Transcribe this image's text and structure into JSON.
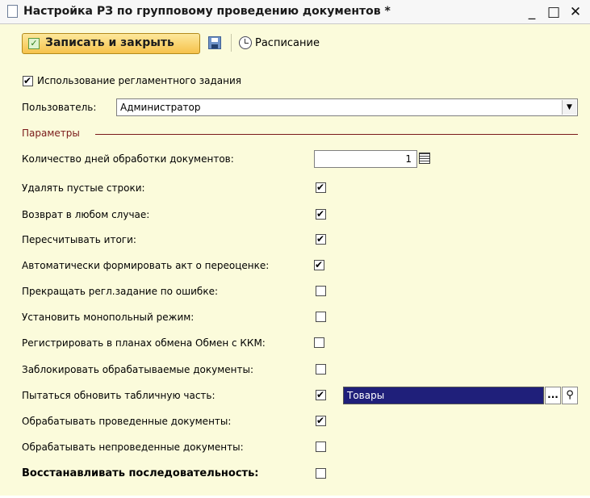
{
  "window": {
    "title": "Настройка РЗ по групповому проведению документов *",
    "controls": {
      "minimize": "_",
      "maximize": "□",
      "close": "✕"
    }
  },
  "toolbar": {
    "save_close_label": "Записать и закрыть",
    "schedule_label": "Расписание"
  },
  "use_task": {
    "label": "Использование регламентного задания",
    "checked": true
  },
  "user": {
    "label": "Пользователь:",
    "value": "Администратор"
  },
  "params": {
    "title": "Параметры",
    "days_label": "Количество дней обработки документов:",
    "days_value": "1",
    "rows": [
      {
        "label": "Удалять пустые строки:",
        "checked": true
      },
      {
        "label": "Возврат в любом случае:",
        "checked": true
      },
      {
        "label": "Пересчитывать итоги:",
        "checked": true
      },
      {
        "label": "Автоматически формировать акт о переоценке:",
        "checked": true
      },
      {
        "label": "Прекращать регл.задание по ошибке:",
        "checked": false
      },
      {
        "label": "Установить монопольный режим:",
        "checked": false
      },
      {
        "label": "Регистрировать в планах обмена Обмен с ККМ:",
        "checked": false
      },
      {
        "label": "Заблокировать обрабатываемые документы:",
        "checked": false
      },
      {
        "label": "Пытаться обновить табличную часть:",
        "checked": true
      },
      {
        "label": "Обрабатывать проведенные документы:",
        "checked": true
      },
      {
        "label": "Обрабатывать непроведенные документы:",
        "checked": false
      },
      {
        "label": "Восстанавливать последовательность:",
        "checked": false
      }
    ],
    "table_part_value": "Товары",
    "ellipsis": "...",
    "dropdown_arrow": "▼"
  },
  "colors": {
    "form_bg": "#fbfbdb",
    "accent_button": "#f6c24b",
    "section_title": "#7a1a1a",
    "selected_field": "#1f1f7a"
  },
  "icons": [
    "document-icon",
    "ok-check-icon",
    "save-floppy-icon",
    "clock-icon",
    "dropdown-arrow-icon",
    "calculator-icon",
    "magnifier-icon"
  ]
}
